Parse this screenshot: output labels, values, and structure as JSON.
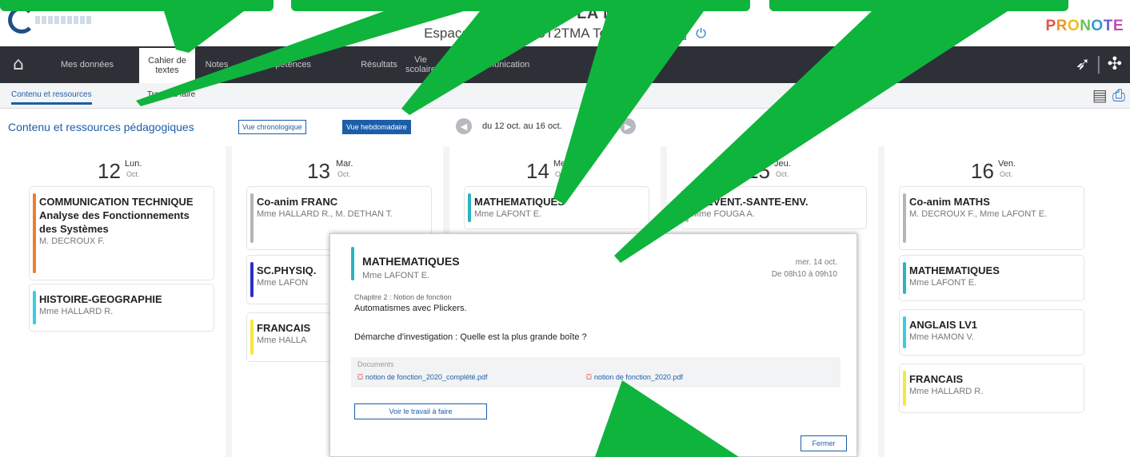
{
  "header": {
    "school_name": "LYCEE DE LA MER",
    "user_line": "Espace Élève - TEST2TMA Test (2TMA)",
    "brand": "PRONOTE"
  },
  "nav": {
    "items": [
      {
        "label": "Mes données"
      },
      {
        "label": "Cahier de textes"
      },
      {
        "label": "Notes"
      },
      {
        "label": "Compétences"
      },
      {
        "label": "Résultats"
      },
      {
        "label": "Vie scolaire"
      },
      {
        "label": "Communication"
      }
    ]
  },
  "subtabs": [
    {
      "label": "Contenu et ressources"
    },
    {
      "label": "Travail à faire"
    }
  ],
  "toolbar": {
    "title": "Contenu et ressources pédagogiques",
    "view_chrono": "Vue chronologique",
    "view_weekly": "Vue hebdomadaire",
    "date_range": "du 12 oct. au 16 oct."
  },
  "days": [
    {
      "num": "12",
      "name": "Lun.",
      "month": "Oct.",
      "cards": [
        {
          "subject": "COMMUNICATION TECHNIQUE Analyse des Fonctionnements des Systèmes",
          "teacher": "M. DECROUX F.",
          "color": "#f07d2a"
        },
        {
          "subject": "HISTOIRE-GEOGRAPHIE",
          "teacher": "Mme HALLARD R.",
          "color": "#34d0e0"
        }
      ]
    },
    {
      "num": "13",
      "name": "Mar.",
      "month": "Oct.",
      "cards": [
        {
          "subject": "Co-anim FRANC",
          "teacher": "Mme HALLARD R., M. DETHAN T.",
          "color": "#b5b5b5"
        },
        {
          "subject": "SC.PHYSIQ.",
          "teacher": "Mme LAFON",
          "color": "#2a2fc4"
        },
        {
          "subject": "FRANCAIS",
          "teacher": "Mme HALLA",
          "color": "#f2e93a"
        }
      ]
    },
    {
      "num": "14",
      "name": "Mer.",
      "month": "Oct.",
      "cards": [
        {
          "subject": "MATHEMATIQUES",
          "teacher": "Mme LAFONT E.",
          "color": "#2bb3c0"
        }
      ]
    },
    {
      "num": "15",
      "name": "Jeu.",
      "month": "Oct.",
      "cards": [
        {
          "subject": "PREVENT.-SANTE-ENV.",
          "teacher": "Mme FOUGA A.",
          "color": "#b5b5b5"
        }
      ]
    },
    {
      "num": "16",
      "name": "Ven.",
      "month": "Oct.",
      "cards": [
        {
          "subject": "Co-anim MATHS",
          "teacher": "M. DECROUX F., Mme LAFONT E.",
          "color": "#b5b5b5"
        },
        {
          "subject": "MATHEMATIQUES",
          "teacher": "Mme LAFONT E.",
          "color": "#2bb3c0"
        },
        {
          "subject": "ANGLAIS LV1",
          "teacher": "Mme HAMON V.",
          "color": "#34d0e0"
        },
        {
          "subject": "FRANCAIS",
          "teacher": "Mme HALLARD R.",
          "color": "#f2e93a"
        }
      ]
    }
  ],
  "popup": {
    "subject": "MATHEMATIQUES",
    "teacher": "Mme LAFONT E.",
    "date": "mer. 14 oct.",
    "time": "De 08h10 à 09h10",
    "chapter": "Chapitre 2 : Notion de fonction",
    "line1": "Automatismes avec Plickers.",
    "line2": "Démarche d'investigation : Quelle est la plus grande boîte ?",
    "docs_label": "Documents",
    "doc1": "notion de fonction_2020_complété.pdf",
    "doc2": "notion de fonction_2020.pdf",
    "work_button": "Voir le travail à faire",
    "close_button": "Fermer"
  },
  "colors": {
    "nav_bg": "#2e3038",
    "accent": "#1c5ea9",
    "annotation": "#0fb43c"
  }
}
